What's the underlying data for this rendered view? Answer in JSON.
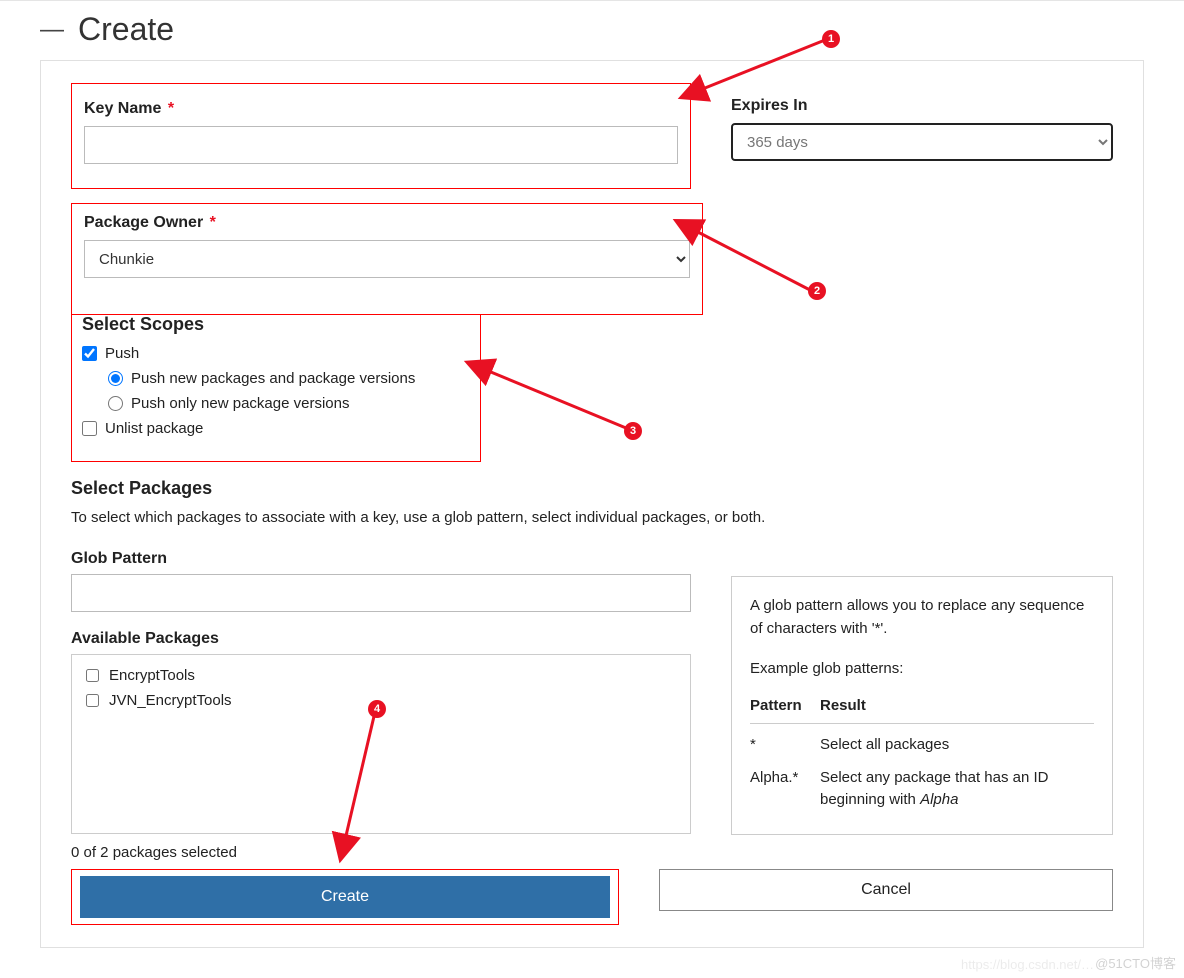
{
  "header": {
    "title": "Create"
  },
  "fields": {
    "keyName": {
      "label": "Key Name",
      "required": "*",
      "value": ""
    },
    "expires": {
      "label": "Expires In",
      "value": "365 days"
    },
    "owner": {
      "label": "Package Owner",
      "required": "*",
      "value": "Chunkie"
    }
  },
  "scopes": {
    "heading": "Select Scopes",
    "push": {
      "label": "Push",
      "checked": true
    },
    "pushNew": {
      "label": "Push new packages and package versions",
      "checked": true
    },
    "pushVer": {
      "label": "Push only new package versions",
      "checked": false
    },
    "unlist": {
      "label": "Unlist package",
      "checked": false
    }
  },
  "packages": {
    "heading": "Select Packages",
    "description": "To select which packages to associate with a key, use a glob pattern, select individual packages, or both.",
    "globLabel": "Glob Pattern",
    "globValue": "",
    "availableLabel": "Available Packages",
    "items": [
      {
        "name": "EncryptTools",
        "checked": false
      },
      {
        "name": "JVN_EncryptTools",
        "checked": false
      }
    ],
    "counter": "0 of 2 packages selected"
  },
  "help": {
    "intro": "A glob pattern allows you to replace any sequence of characters with '*'.",
    "examplesHeading": "Example glob patterns:",
    "colPattern": "Pattern",
    "colResult": "Result",
    "rows": [
      {
        "pattern": "*",
        "result_pre": "Select all packages",
        "result_em": ""
      },
      {
        "pattern": "Alpha.*",
        "result_pre": "Select any package that has an ID beginning with ",
        "result_em": "Alpha"
      }
    ]
  },
  "buttons": {
    "create": "Create",
    "cancel": "Cancel"
  },
  "watermark": "@51CTO博客",
  "watermark2": "https://blog.csdn.net/…"
}
